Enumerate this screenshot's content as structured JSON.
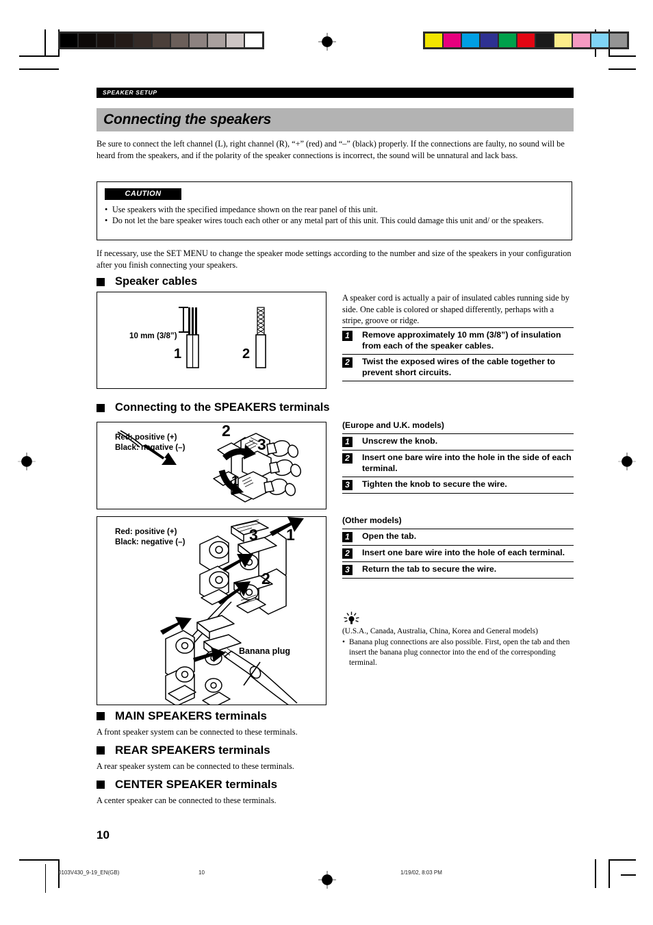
{
  "running_head": "SPEAKER SETUP",
  "title": "Connecting the speakers",
  "intro": "Be sure to connect the left channel (L), right channel (R), “+” (red) and “–” (black) properly. If the connections are faulty, no sound will be heard from the speakers, and if the polarity of the speaker connections is incorrect, the sound will be unnatural and lack bass.",
  "caution": {
    "tag": "CAUTION",
    "items": [
      "Use speakers with the specified impedance shown on the rear panel of this unit.",
      "Do not let the bare speaker wires touch each other or any metal part of this unit. This could damage this unit and/ or the speakers."
    ]
  },
  "after_caution": "If necessary, use the SET MENU to change the speaker mode settings according to the number and size of the speakers in your configuration after you finish connecting your speakers.",
  "speaker_cables": {
    "heading": "Speaker cables",
    "figure": {
      "dimension_label": "10 mm (3/8”)",
      "callout_1": "1",
      "callout_2": "2"
    },
    "description": "A speaker cord is actually a pair of insulated cables running side by side. One cable is colored or shaped differently, perhaps with a stripe, groove or ridge.",
    "steps": [
      {
        "num": "1",
        "text": "Remove approximately 10 mm (3/8”) of insulation from each of the speaker cables."
      },
      {
        "num": "2",
        "text": "Twist the exposed wires of the cable together to prevent short circuits."
      }
    ]
  },
  "terminals": {
    "heading": "Connecting to the SPEAKERS terminals",
    "legend_red": "Red: positive (+)",
    "legend_black": "Black: negative (–)",
    "fig1_callouts": [
      "1",
      "2",
      "3"
    ],
    "fig2_callouts": [
      "1",
      "2",
      "3"
    ],
    "banana_label": "Banana plug",
    "europe": {
      "header": "(Europe and U.K. models)",
      "steps": [
        {
          "num": "1",
          "text": "Unscrew the knob."
        },
        {
          "num": "2",
          "text": "Insert one bare wire into the hole in the side of each terminal."
        },
        {
          "num": "3",
          "text": "Tighten the knob to secure the wire."
        }
      ]
    },
    "other": {
      "header": "(Other models)",
      "steps": [
        {
          "num": "1",
          "text": "Open the tab."
        },
        {
          "num": "2",
          "text": "Insert one bare wire into the hole of each terminal."
        },
        {
          "num": "3",
          "text": "Return the tab to secure the wire."
        }
      ]
    },
    "tip": {
      "models": "(U.S.A., Canada, Australia, China, Korea and General models)",
      "bullet": "Banana plug connections are also possible. First, open the tab and then insert the banana plug connector into the end of the corresponding terminal."
    }
  },
  "terminal_sections": [
    {
      "heading": "MAIN SPEAKERS terminals",
      "text": "A front speaker system can be connected to these terminals."
    },
    {
      "heading": "REAR SPEAKERS terminals",
      "text": "A rear speaker system can be connected to these terminals."
    },
    {
      "heading": "CENTER SPEAKER terminals",
      "text": "A center speaker can be connected to these terminals."
    }
  ],
  "page_number": "10",
  "footer": {
    "file": "0103V430_9-19_EN(GB)",
    "page": "10",
    "timestamp": "1/19/02, 8:03 PM"
  },
  "calibration": {
    "gray_swatches": [
      "#000000",
      "#0d0908",
      "#17100e",
      "#241b18",
      "#342a26",
      "#4b3f3a",
      "#6b5f5a",
      "#8d8280",
      "#a9a09e",
      "#cdc5c4",
      "#ffffff"
    ],
    "color_swatches": [
      "#f2e500",
      "#e6007e",
      "#009fe3",
      "#2e3192",
      "#00a14b",
      "#e30613",
      "#1a1a1a",
      "#fced8a",
      "#f49ac1",
      "#7fd4f5",
      "#949494"
    ]
  }
}
